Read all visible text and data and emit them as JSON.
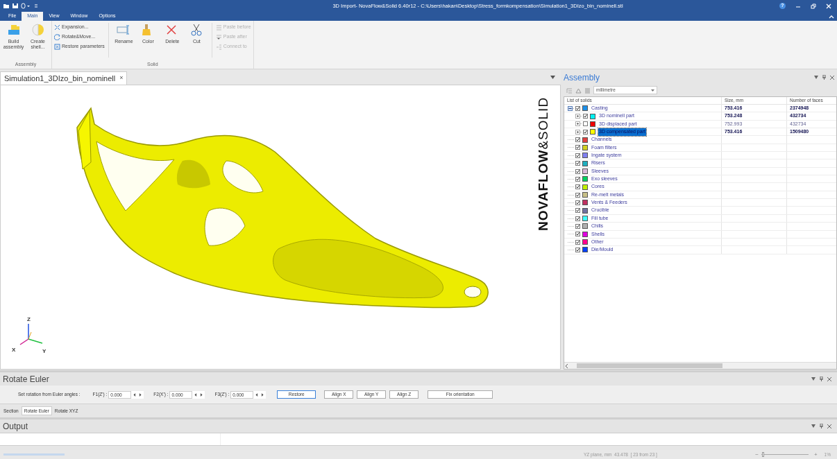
{
  "window": {
    "title": "3D Import- NovaFlow&Solid  6.40r12 - C:\\Users\\hakan\\Desktop\\Stress_formkompensation\\Simulation1_3DIzo_bin_nominell.stl",
    "help": "?"
  },
  "menu_tabs": [
    {
      "label": "File",
      "selected": false
    },
    {
      "label": "Main",
      "selected": true
    },
    {
      "label": "View",
      "selected": false
    },
    {
      "label": "Window",
      "selected": false
    },
    {
      "label": "Options",
      "selected": false
    }
  ],
  "ribbon": {
    "groups": [
      {
        "label": "Assembly",
        "buttons": [
          {
            "kind": "large",
            "label": "Build assembly",
            "disabled": false
          },
          {
            "kind": "large",
            "label": "Create shell...",
            "disabled": false
          }
        ]
      },
      {
        "label": "Solid",
        "buttons": [
          {
            "kind": "small",
            "label": "Expansion...",
            "disabled": false
          },
          {
            "kind": "small",
            "label": "Rotate&Move...",
            "disabled": false
          },
          {
            "kind": "small",
            "label": "Restore parameters",
            "disabled": false
          },
          {
            "kind": "large",
            "label": "Rename",
            "disabled": false
          },
          {
            "kind": "large",
            "label": "Color",
            "disabled": false
          },
          {
            "kind": "large",
            "label": "Delete",
            "disabled": false
          },
          {
            "kind": "large",
            "label": "Cut",
            "disabled": false
          },
          {
            "kind": "small",
            "label": "Paste before",
            "disabled": true
          },
          {
            "kind": "small",
            "label": "Paste after",
            "disabled": true
          },
          {
            "kind": "small",
            "label": "Connect to",
            "disabled": true
          }
        ]
      }
    ]
  },
  "document_tab": {
    "label": "Simulation1_3DIzo_bin_nominell",
    "close": "×"
  },
  "viewer": {
    "logo": "**NOVAFLOW**&SOLID",
    "axes": [
      "Z",
      "X",
      "Y"
    ]
  },
  "assembly": {
    "title": "Assembly",
    "unit": "millimetre",
    "columns": [
      "List of solids",
      "Size, mm",
      "Number of faces"
    ],
    "tree": [
      {
        "label": "Casting",
        "checked": true,
        "color": "#1e90e8",
        "size": "753.416",
        "faces": "2374948",
        "selected": false,
        "expanded": true,
        "children": [
          {
            "label": "3D nominell part",
            "checked": true,
            "color": "#00f0f0",
            "size": "753.248",
            "faces": "432734",
            "selected": false,
            "expanded": false
          },
          {
            "label": "3D displaced part",
            "checked": false,
            "color": "#f00000",
            "size": "752.993",
            "faces": "432734",
            "selected": false,
            "expanded": false
          },
          {
            "label": "3D compensated part",
            "checked": true,
            "color": "#ffff00",
            "size": "753.416",
            "faces": "1509480",
            "selected": true,
            "expanded": false
          }
        ]
      },
      {
        "label": "Channels",
        "checked": true,
        "color": "#e04040",
        "selected": false
      },
      {
        "label": "Foam filters",
        "checked": true,
        "color": "#d0d020",
        "selected": false
      },
      {
        "label": "Ingate system",
        "checked": true,
        "color": "#8080f0",
        "selected": false
      },
      {
        "label": "Risers",
        "checked": true,
        "color": "#20b0c0",
        "selected": false
      },
      {
        "label": "Sleeves",
        "checked": true,
        "color": "#d8b8d8",
        "selected": false
      },
      {
        "label": "Exo sleeves",
        "checked": true,
        "color": "#00d060",
        "selected": false
      },
      {
        "label": "Cores",
        "checked": true,
        "color": "#c0f000",
        "selected": false
      },
      {
        "label": "Re-melt metals",
        "checked": true,
        "color": "#c8c088",
        "selected": false
      },
      {
        "label": "Vents & Feeders",
        "checked": true,
        "color": "#c03060",
        "selected": false
      },
      {
        "label": "Crucible",
        "checked": true,
        "color": "#7070a0",
        "selected": false
      },
      {
        "label": "Fill tube",
        "checked": true,
        "color": "#40ffff",
        "selected": false
      },
      {
        "label": "Chills",
        "checked": true,
        "color": "#b0b0b0",
        "selected": false
      },
      {
        "label": "Shells",
        "checked": true,
        "color": "#e000e0",
        "selected": false
      },
      {
        "label": "Other",
        "checked": true,
        "color": "#ff0090",
        "selected": false
      },
      {
        "label": "Die/Mould",
        "checked": true,
        "color": "#0040ff",
        "selected": false
      }
    ]
  },
  "rotate_panel": {
    "title": "Rotate Euler",
    "prompt": "Set rotation from Euler  angles :",
    "fields": [
      {
        "label": "F1(Z') :",
        "value": "0.000"
      },
      {
        "label": "F2(X') :",
        "value": "0.000"
      },
      {
        "label": "F3(Z') :",
        "value": "0.000"
      }
    ],
    "buttons": [
      {
        "label": "Restore",
        "focused": true
      },
      {
        "label": "Align X",
        "focused": false
      },
      {
        "label": "Align Y",
        "focused": false
      },
      {
        "label": "Align Z",
        "focused": false
      },
      {
        "label": "Fix orientation",
        "focused": false
      }
    ],
    "tabs": [
      {
        "label": "Section",
        "selected": false
      },
      {
        "label": "Rotate Euler",
        "selected": true
      },
      {
        "label": "Rotate XYZ",
        "selected": false
      }
    ]
  },
  "output_panel": {
    "title": "Output"
  },
  "status_bar": {
    "progress": {
      "level": 1
    },
    "info": "YZ plane, mm  43.478  [ 23 from 23 ]",
    "zoom_minus": "−",
    "zoom": {
      "level": 0.02
    },
    "zoom_plus": "+",
    "zoom_reading": "1%"
  }
}
